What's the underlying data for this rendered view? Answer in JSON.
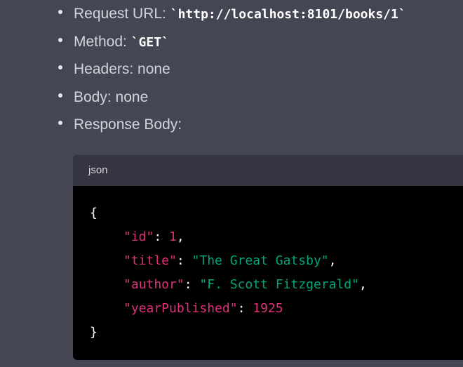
{
  "bullets": [
    {
      "label": "Request URL: ",
      "code": "`http://localhost:8101/books/1`"
    },
    {
      "label": "Method: ",
      "code": "`GET`"
    },
    {
      "label": "Headers: none",
      "code": ""
    },
    {
      "label": "Body: none",
      "code": ""
    },
    {
      "label": "Response Body:",
      "code": ""
    }
  ],
  "codeblock": {
    "language": "json",
    "open_brace": "{",
    "close_brace": "}",
    "lines": [
      {
        "key": "\"id\"",
        "value": "1",
        "value_type": "number",
        "trail": ","
      },
      {
        "key": "\"title\"",
        "value": "\"The Great Gatsby\"",
        "value_type": "string",
        "trail": ","
      },
      {
        "key": "\"author\"",
        "value": "\"F. Scott Fitzgerald\"",
        "value_type": "string",
        "trail": ","
      },
      {
        "key": "\"yearPublished\"",
        "value": "1925",
        "value_type": "number",
        "trail": ""
      }
    ]
  },
  "colors": {
    "background": "#444654",
    "code_bg": "#000000",
    "code_header_bg": "#343541",
    "json_key": "#df3079",
    "json_string": "#00a67d",
    "json_number": "#df3079"
  }
}
